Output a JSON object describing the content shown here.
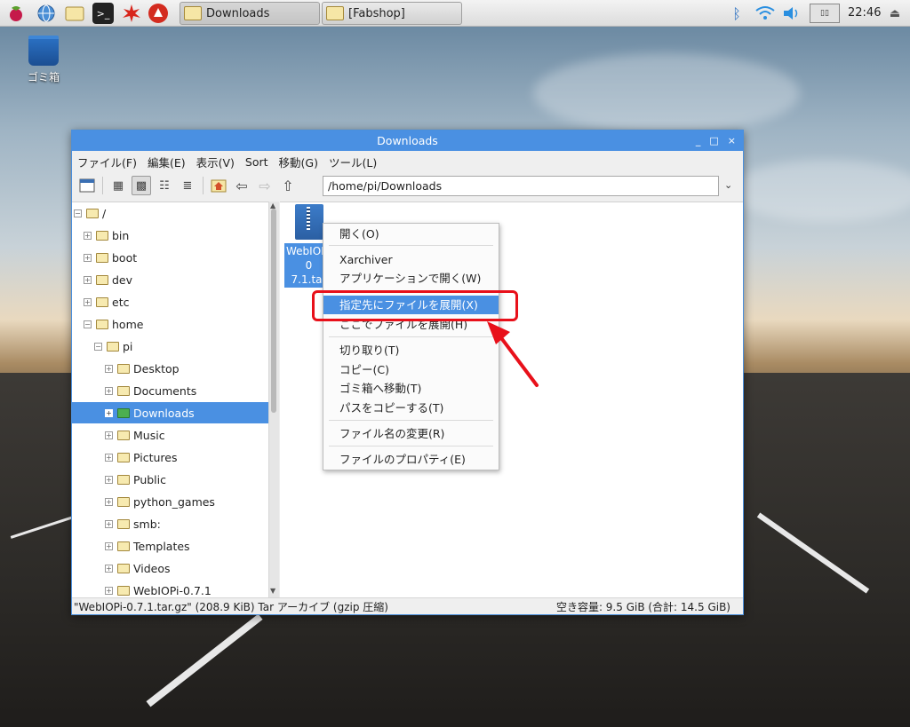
{
  "taskbar": {
    "windows": [
      {
        "label": "Downloads"
      },
      {
        "label": "[Fabshop]"
      }
    ],
    "clock": "22:46"
  },
  "desktop": {
    "trash_label": "ゴミ箱"
  },
  "window": {
    "title": "Downloads",
    "controls": [
      "_",
      "□",
      "×"
    ],
    "menu": [
      "ファイル(F)",
      "編集(E)",
      "表示(V)",
      "Sort",
      "移動(G)",
      "ツール(L)"
    ],
    "path": "/home/pi/Downloads",
    "tree": [
      {
        "label": "/",
        "expander": "−"
      },
      {
        "label": "bin",
        "expander": "+"
      },
      {
        "label": "boot",
        "expander": "+"
      },
      {
        "label": "dev",
        "expander": "+"
      },
      {
        "label": "etc",
        "expander": "+"
      },
      {
        "label": "home",
        "expander": "−"
      },
      {
        "label": "pi",
        "expander": "−"
      },
      {
        "label": "Desktop",
        "expander": "+"
      },
      {
        "label": "Documents",
        "expander": "+"
      },
      {
        "label": "Downloads",
        "expander": "+"
      },
      {
        "label": "Music",
        "expander": "+"
      },
      {
        "label": "Pictures",
        "expander": "+"
      },
      {
        "label": "Public",
        "expander": "+"
      },
      {
        "label": "python_games",
        "expander": "+"
      },
      {
        "label": "smb:",
        "expander": "+"
      },
      {
        "label": "Templates",
        "expander": "+"
      },
      {
        "label": "Videos",
        "expander": "+"
      },
      {
        "label": "WebIOPi-0.7.1",
        "expander": "+"
      }
    ],
    "file": {
      "label_line1": "WebIOPi-0",
      "label_line2": "7.1.tar"
    },
    "status_left": "\"WebIOPi-0.7.1.tar.gz\" (208.9 KiB) Tar アーカイブ (gzip 圧縮)",
    "status_right": "空き容量: 9.5 GiB (合計: 14.5 GiB)"
  },
  "context_menu": {
    "items": [
      "開く(O)",
      "Xarchiver",
      "アプリケーションで開く(W)",
      "指定先にファイルを展開(X)",
      "ここでファイルを展開(H)",
      "切り取り(T)",
      "コピー(C)",
      "ゴミ箱へ移動(T)",
      "パスをコピーする(T)",
      "ファイル名の変更(R)",
      "ファイルのプロパティ(E)"
    ],
    "highlighted_index": 3
  },
  "colors": {
    "accent": "#4a90e2",
    "annotation_red": "#e8101a"
  }
}
